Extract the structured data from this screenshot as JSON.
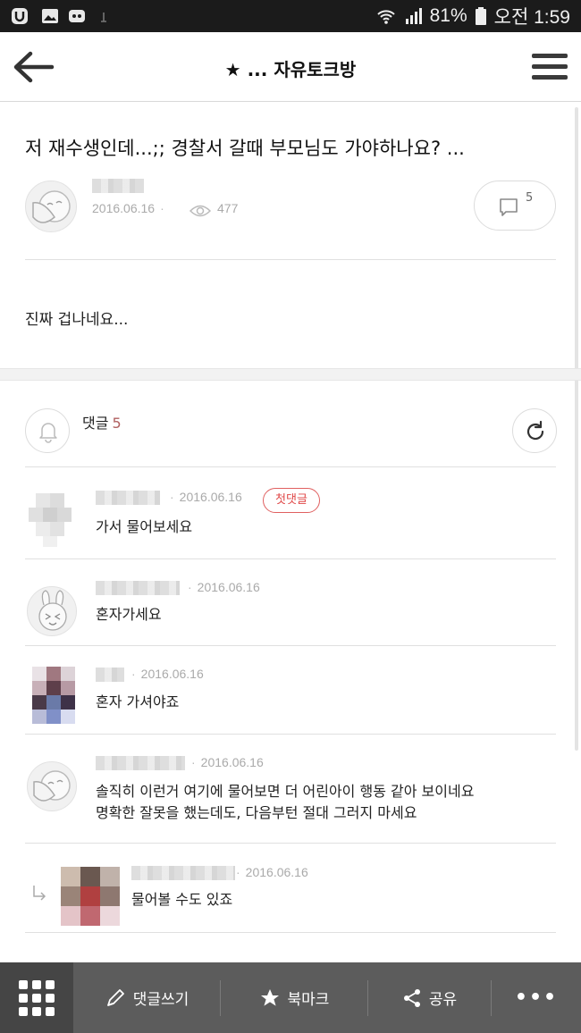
{
  "status_bar": {
    "battery": "81%",
    "time": "오전 1:59"
  },
  "header": {
    "board_title": "★ ... 자유토크방"
  },
  "post": {
    "title": "저 재수생인데...;; 경찰서 갈때 부모님도 가야하나요? ...",
    "date": "2016.06.16",
    "views": "477",
    "comment_count": "5",
    "body": "진짜 겁나네요..."
  },
  "comments_section": {
    "label": "댓글",
    "count": "5",
    "first_comment_badge": "첫댓글",
    "items": [
      {
        "date": "2016.06.16",
        "text": "가서 물어보세요"
      },
      {
        "date": "2016.06.16",
        "text": "혼자가세요"
      },
      {
        "date": "2016.06.16",
        "text": "혼자 가셔야죠"
      },
      {
        "date": "2016.06.16",
        "text_line1": "솔직히 이런거 여기에 물어보면 더 어린아이 행동 같아 보이네요",
        "text_line2": "명확한 잘못을 했는데도, 다음부턴 절대 그러지 마세요"
      },
      {
        "date": "2016.06.16",
        "text": "물어볼 수도 있죠"
      }
    ]
  },
  "bottom_bar": {
    "write_comment": "댓글쓰기",
    "bookmark": "북마크",
    "share": "공유",
    "more": "•••"
  },
  "colors": {
    "status_bar_bg": "#1b1b1b",
    "bottom_bar_bg": "#5c5c5c",
    "accent_count": "#b06060",
    "badge_red": "#e04848"
  },
  "icons": [
    "app-logo-icon",
    "image-icon",
    "gamepad-icon",
    "usb-icon",
    "wifi-icon",
    "signal-icon",
    "battery-icon",
    "back-arrow-icon",
    "hamburger-menu-icon",
    "eye-icon",
    "comment-bubble-icon",
    "bell-icon",
    "refresh-icon",
    "reply-arrow-icon",
    "grid-icon",
    "pencil-icon",
    "star-icon",
    "share-icon"
  ]
}
